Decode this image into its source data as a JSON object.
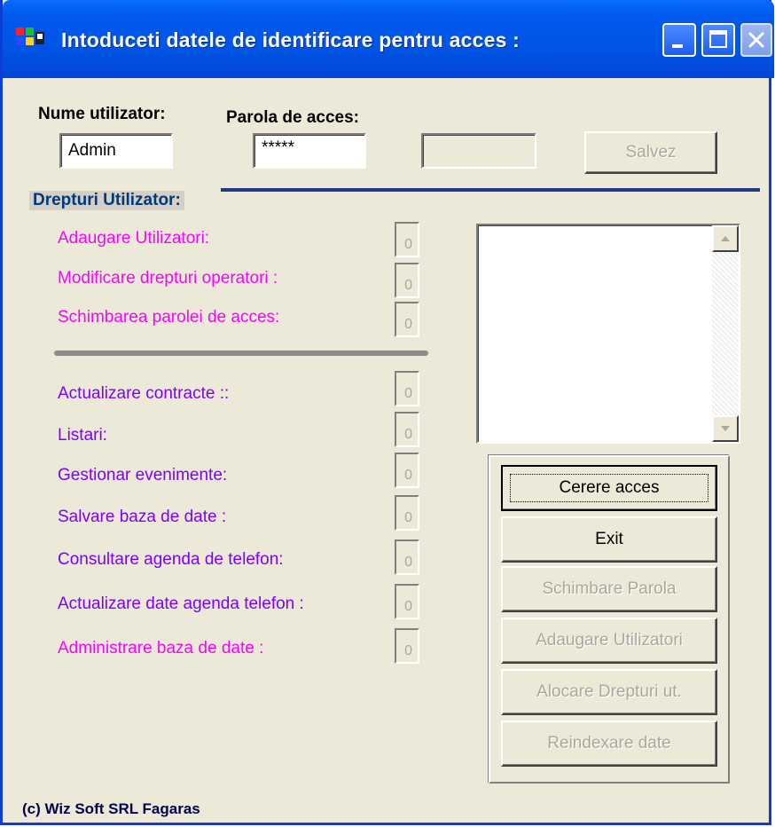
{
  "window": {
    "title": "Intoduceti datele de identificare pentru acces :"
  },
  "login": {
    "username_label": "Nume utilizator:",
    "username_value": "Admin",
    "password_label": "Parola de acces:",
    "password_value": "*****",
    "extra_field_value": "",
    "save_button": "Salvez"
  },
  "rights": {
    "section_title": "Drepturi Utilizator:",
    "items": [
      {
        "label": "Adaugare Utilizatori:",
        "value": "0",
        "color": "#FF00FF"
      },
      {
        "label": "Modificare drepturi operatori :",
        "value": "0",
        "color": "#FF00FF"
      },
      {
        "label": "Schimbarea parolei de acces:",
        "value": "0",
        "color": "#FF00FF"
      },
      {
        "label": "Actualizare contracte ::",
        "value": "0",
        "color": "#7F00FF"
      },
      {
        "label": "Listari:",
        "value": "0",
        "color": "#7F00FF"
      },
      {
        "label": "Gestionar evenimente:",
        "value": "0",
        "color": "#7F00FF"
      },
      {
        "label": "Salvare baza de date :",
        "value": "0",
        "color": "#7F00FF"
      },
      {
        "label": "Consultare agenda de telefon:",
        "value": "0",
        "color": "#7F00FF"
      },
      {
        "label": "Actualizare date agenda telefon :",
        "value": "0",
        "color": "#7F00FF"
      },
      {
        "label": "Administrare baza de date :",
        "value": "0",
        "color": "#FF00FF"
      }
    ]
  },
  "actions": {
    "cerere_acces": "Cerere acces",
    "exit": "Exit",
    "schimbare_parola": "Schimbare Parola",
    "adaugare_utilizatori": "Adaugare Utilizatori",
    "alocare_drepturi": "Alocare Drepturi ut.",
    "reindexare_date": "Reindexare date"
  },
  "footer": {
    "copyright": "(c) Wiz Soft SRL Fagaras"
  },
  "colors": {
    "titlebar": "#0055E5",
    "window_bg": "#ECE9D8",
    "section_line": "#1F3B82",
    "pink_label": "#FF00FF",
    "purple_label": "#7F00FF",
    "disabled_text": "#ACA899"
  }
}
